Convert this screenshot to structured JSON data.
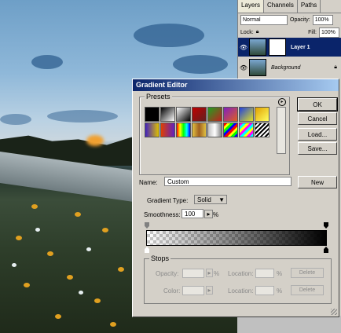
{
  "layers_panel": {
    "tabs": [
      "Layers",
      "Channels",
      "Paths"
    ],
    "blend_mode": "Normal",
    "opacity_label": "Opacity:",
    "opacity_value": "100%",
    "lock_label": "Lock:",
    "fill_label": "Fill:",
    "fill_value": "100%",
    "layers": [
      {
        "name": "Layer 1",
        "selected": true
      },
      {
        "name": "Background",
        "selected": false
      }
    ]
  },
  "dialog": {
    "title": "Gradient Editor",
    "presets_label": "Presets",
    "buttons": {
      "ok": "OK",
      "cancel": "Cancel",
      "load": "Load...",
      "save": "Save...",
      "new": "New"
    },
    "name_label": "Name:",
    "name_value": "Custom",
    "gradient_type_label": "Gradient Type:",
    "gradient_type_value": "Solid",
    "smoothness_label": "Smoothness:",
    "smoothness_value": "100",
    "smoothness_unit": "%",
    "stops_label": "Stops",
    "opacity_label": "Opacity:",
    "color_label": "Color:",
    "location_label": "Location:",
    "percent": "%",
    "delete_label": "Delete"
  },
  "colors": {
    "accent": "#0a246a",
    "dialog_bg": "#d4d0c8"
  }
}
